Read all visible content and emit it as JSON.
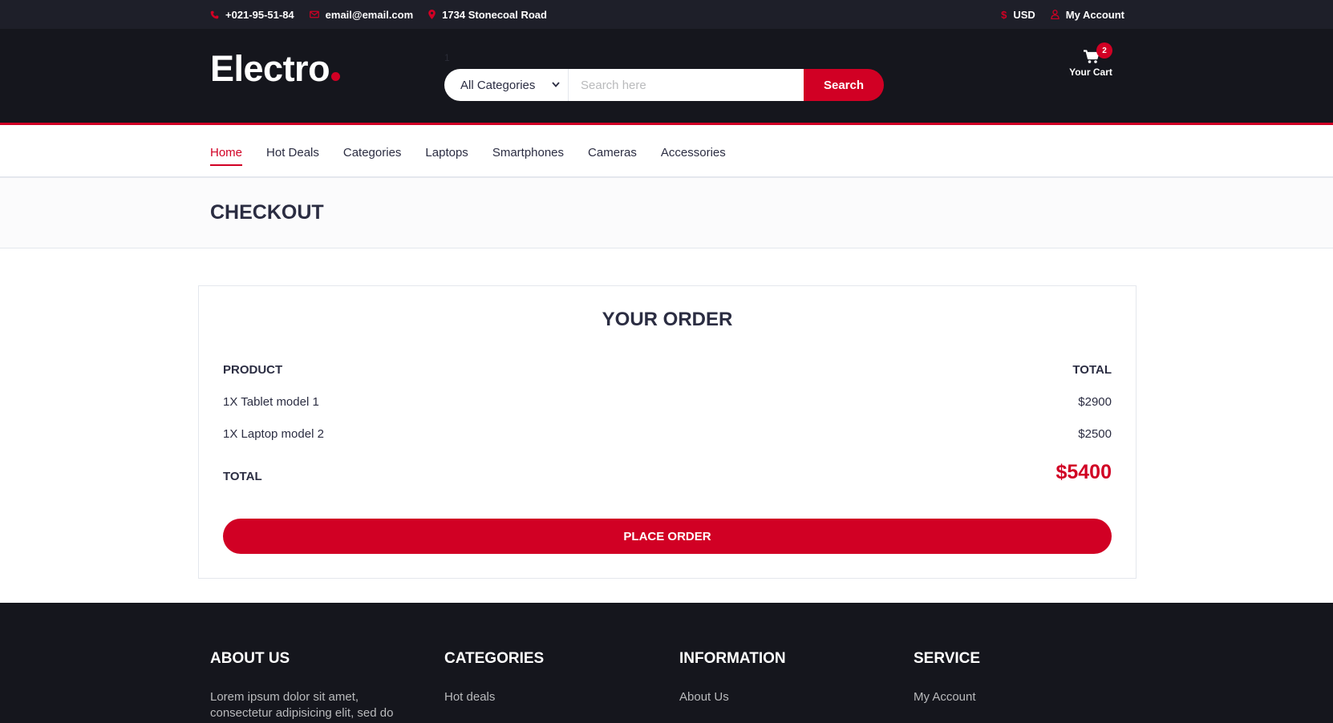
{
  "topbar": {
    "phone": "+021-95-51-84",
    "email": "email@email.com",
    "address": "1734 Stonecoal Road",
    "currency": "USD",
    "account": "My Account",
    "icons": [
      "phone-icon",
      "envelope-icon",
      "map-marker-icon",
      "dollar-icon",
      "user-icon"
    ]
  },
  "header": {
    "logo": "Electro",
    "tiny_mark": "1",
    "category_select": "All Categories",
    "search_placeholder": "Search here",
    "search_button": "Search",
    "cart_label": "Your Cart",
    "cart_count": "2"
  },
  "nav": {
    "items": [
      "Home",
      "Hot Deals",
      "Categories",
      "Laptops",
      "Smartphones",
      "Cameras",
      "Accessories"
    ],
    "active": "Home"
  },
  "breadcrumb": {
    "title": "CHECKOUT"
  },
  "order": {
    "title": "YOUR ORDER",
    "col_product": "PRODUCT",
    "col_total": "TOTAL",
    "items": [
      {
        "name": "1X Tablet model 1",
        "price": "$2900"
      },
      {
        "name": "1X Laptop model 2",
        "price": "$2500"
      }
    ],
    "total_label": "TOTAL",
    "total_value": "$5400",
    "place_order": "PLACE ORDER"
  },
  "footer": {
    "about": {
      "title": "ABOUT US",
      "text": "Lorem ipsum dolor sit amet, consectetur adipisicing elit, sed do"
    },
    "categories": {
      "title": "CATEGORIES",
      "links": [
        "Hot deals"
      ]
    },
    "information": {
      "title": "INFORMATION",
      "links": [
        "About Us"
      ]
    },
    "service": {
      "title": "SERVICE",
      "links": [
        "My Account"
      ]
    }
  },
  "colors": {
    "accent": "#d10024",
    "dark_header": "#15161d",
    "topbar": "#1e1f29",
    "text": "#2b2d42"
  }
}
